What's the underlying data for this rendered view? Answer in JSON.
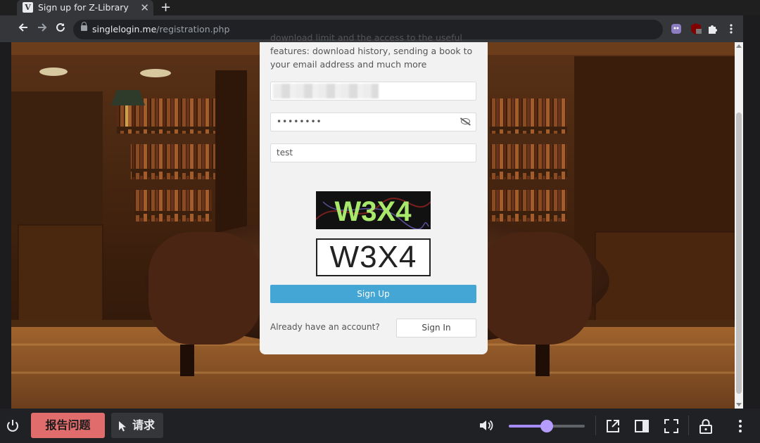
{
  "browser": {
    "tab_title": "Sign up for Z-Library",
    "tab_favicon": "V",
    "new_tab": "+",
    "url_host": "singlelogin.me",
    "url_path": "/registration.php"
  },
  "form": {
    "intro_partial": "download limit and the access to the useful features: download history, sending a book to your email address and much more",
    "password_mask": "••••••••",
    "name_value": "test",
    "captcha_image_text": "W3X4",
    "captcha_input_value": "W3X4",
    "signup_label": "Sign Up",
    "already_text": "Already have an account?",
    "signin_label": "Sign In"
  },
  "bottom_bar": {
    "report_label": "报告问题",
    "request_label": "请求",
    "volume_level": 0.5
  },
  "icons": {
    "power": "power-icon",
    "volume": "volume-icon",
    "external": "open-external-icon",
    "sidebar": "sidebar-icon",
    "fullscreen": "fullscreen-icon",
    "lock": "lock-icon",
    "more": "more-vertical-icon"
  },
  "colors": {
    "signup_button": "#44a6d5",
    "report_button": "#e06c6c",
    "volume_accent": "#a78bfa"
  }
}
